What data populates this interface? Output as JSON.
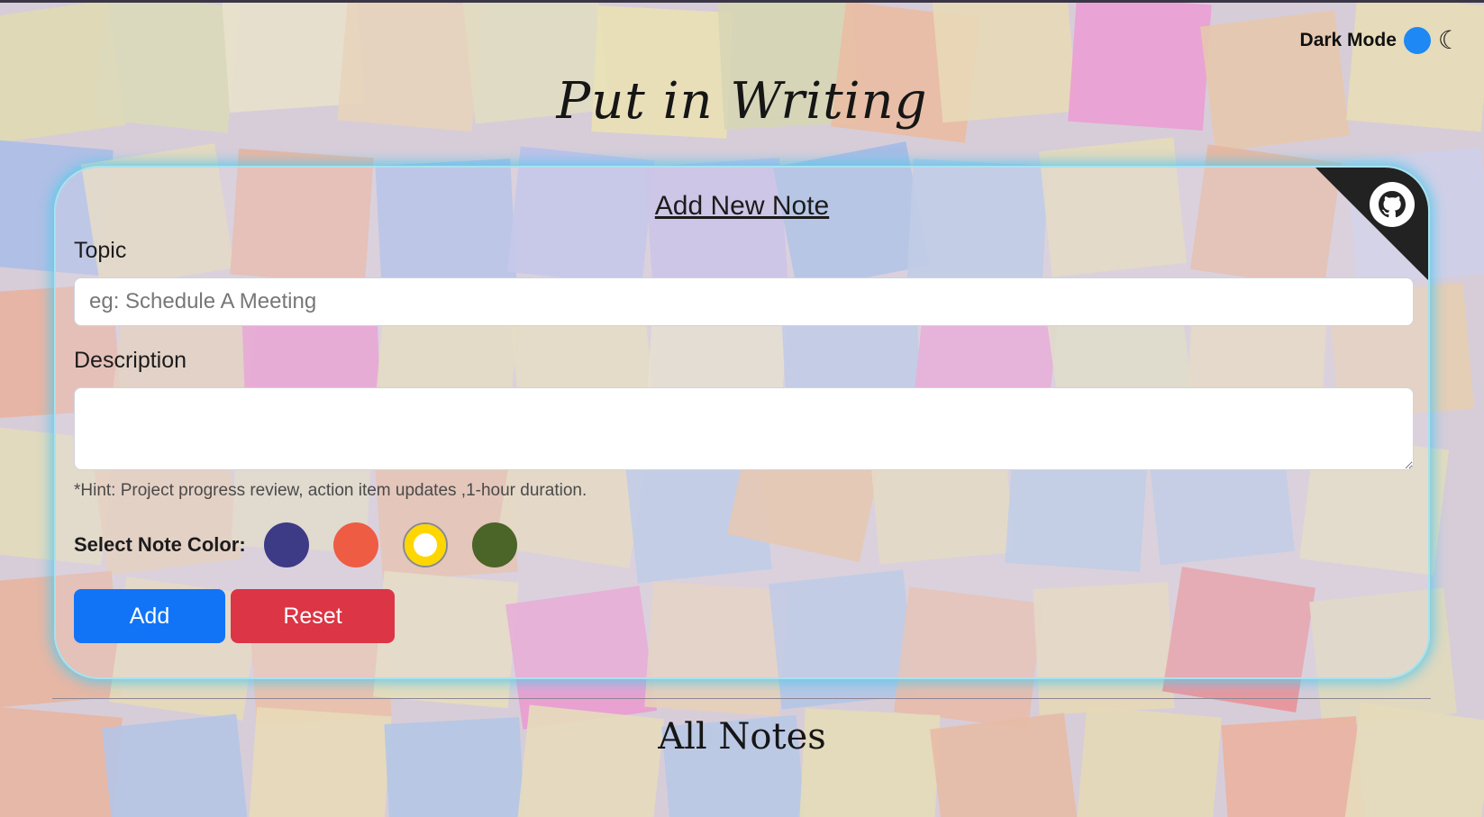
{
  "header": {
    "dark_mode_label": "Dark Mode",
    "app_title": "Put in Writing"
  },
  "form": {
    "title": "Add New Note",
    "topic_label": "Topic",
    "topic_placeholder": "eg: Schedule A Meeting",
    "topic_value": "",
    "description_label": "Description",
    "description_value": "",
    "hint": "*Hint: Project progress review, action item updates ,1-hour duration.",
    "color_label": "Select Note Color:",
    "colors": [
      "#3d3a86",
      "#ee5c44",
      "#ffd600",
      "#4b6428"
    ],
    "selected_color_index": 2,
    "add_label": "Add",
    "reset_label": "Reset"
  },
  "notes_section": {
    "heading": "All Notes"
  },
  "icons": {
    "github": "github-icon",
    "moon": "moon-icon"
  },
  "theme": {
    "accent_blue": "#1174f7",
    "danger_red": "#dc3545",
    "glow": "#5ac8eb"
  }
}
